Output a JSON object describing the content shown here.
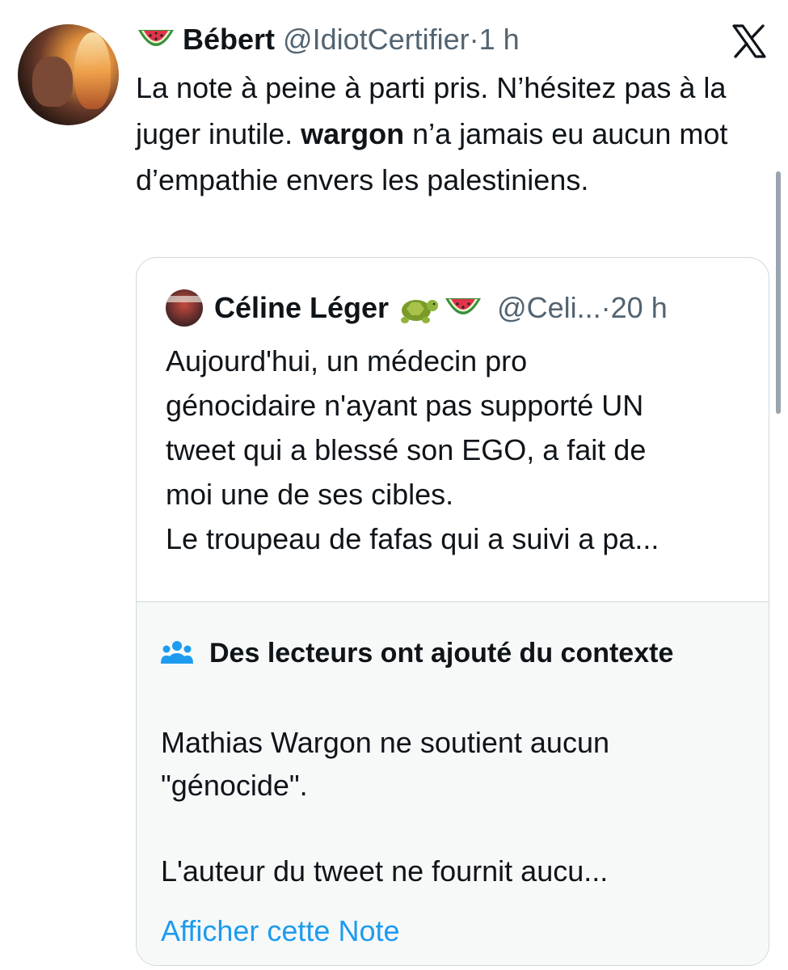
{
  "tweet": {
    "author_name": "Bébert",
    "author_emoji": "watermelon-emoji",
    "handle": "@IdiotCertifier",
    "separator": "·",
    "time": "1 h",
    "text_part1": "La note à peine à parti pris. N’hésitez pas à la juger inutile. ",
    "text_bold": "wargon",
    "text_part2": " n’a jamais eu aucun mot d’empathie envers les palestiniens."
  },
  "quoted": {
    "author_name": "Céline Léger",
    "author_emojis": [
      "turtle-emoji",
      "watermelon-emoji"
    ],
    "handle": "@Celi...",
    "separator": "·",
    "time": "20 h",
    "lines": [
      "Aujourd'hui, un médecin pro",
      "génocidaire n'ayant pas supporté UN",
      "tweet qui a blessé son EGO, a fait de",
      "moi une de ses cibles.",
      "Le troupeau de fafas qui a suivi a pa..."
    ]
  },
  "community_note": {
    "title": "Des lecteurs ont ajouté du contexte",
    "lines": [
      "Mathias Wargon ne soutient aucun",
      "\"génocide\".",
      "",
      "L'auteur du tweet ne fournit aucu..."
    ],
    "link_label": "Afficher cette Note"
  },
  "colors": {
    "text": "#0f1419",
    "secondary": "#536471",
    "link": "#1d9bf0",
    "note_bg": "#f7f9f9",
    "border": "#cfd9de"
  }
}
